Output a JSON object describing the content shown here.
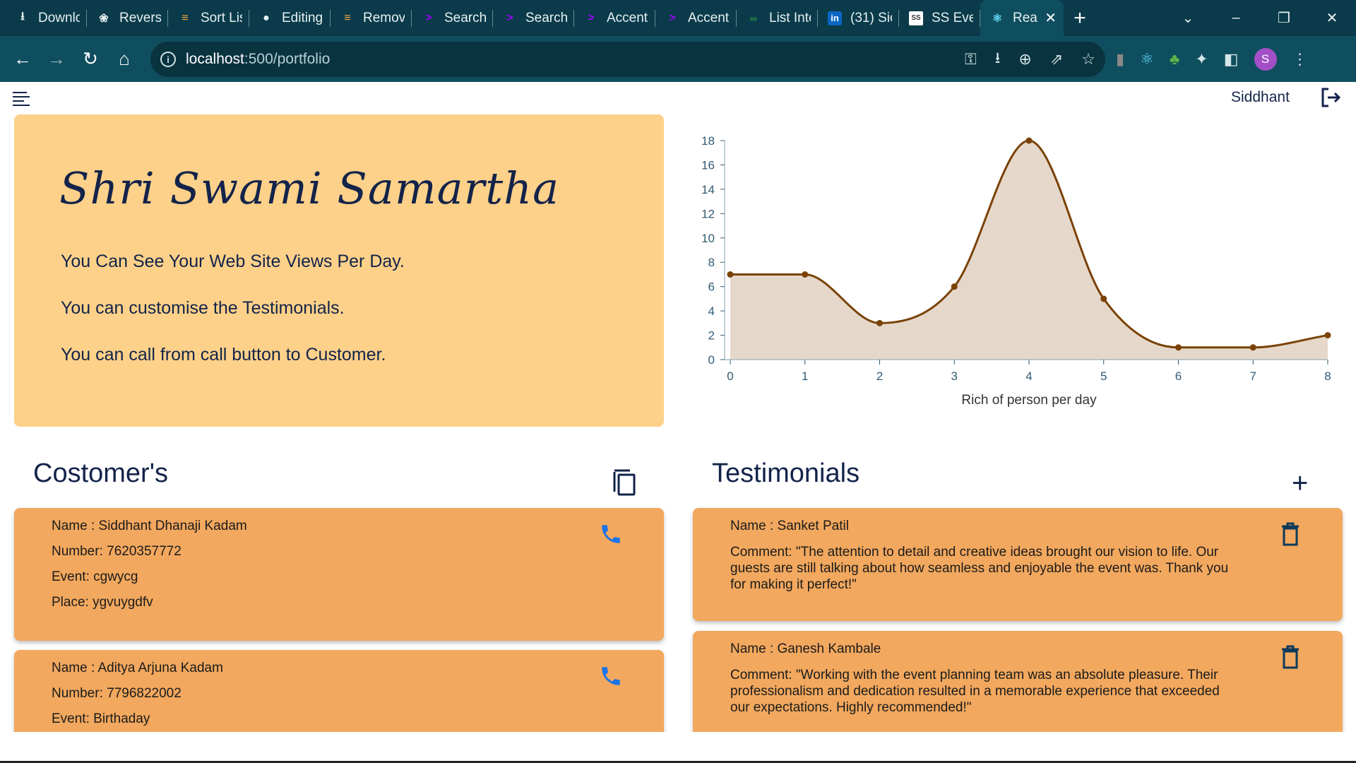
{
  "browser": {
    "tabs": [
      {
        "label": "Downlo",
        "icon": "download-icon"
      },
      {
        "label": "Reverse",
        "icon": "openai-icon"
      },
      {
        "label": "Sort Lis",
        "icon": "stackoverflow-icon"
      },
      {
        "label": "Editing",
        "icon": "github-icon"
      },
      {
        "label": "Remov",
        "icon": "stackoverflow-icon"
      },
      {
        "label": "Search",
        "icon": "accenture-icon"
      },
      {
        "label": "Search",
        "icon": "accenture-icon"
      },
      {
        "label": "Accent",
        "icon": "accenture-icon"
      },
      {
        "label": "Accent",
        "icon": "accenture-icon"
      },
      {
        "label": "List Inte",
        "icon": "gfg-icon"
      },
      {
        "label": "(31) Sic",
        "icon": "linkedin-icon"
      },
      {
        "label": "SS Even",
        "icon": "ss-icon"
      },
      {
        "label": "Rea",
        "icon": "react-icon",
        "active": true
      }
    ],
    "url_host": "localhost",
    "url_rest": ":500/portfolio"
  },
  "header": {
    "username": "Siddhant"
  },
  "hero": {
    "title": "Shri Swami Samartha",
    "lines": [
      "You Can See Your Web Site Views Per Day.",
      "You can customise the Testimonials.",
      "You can call from call button to Customer."
    ]
  },
  "chart_data": {
    "type": "area",
    "x": [
      0,
      1,
      2,
      3,
      4,
      5,
      6,
      7,
      8
    ],
    "values": [
      7,
      7,
      3,
      6,
      18,
      5,
      1,
      1,
      2
    ],
    "xlabel": "Rich of person per day",
    "ylabel": "",
    "xlim": [
      0,
      8
    ],
    "ylim": [
      0,
      18
    ],
    "yticks": [
      0,
      2,
      4,
      6,
      8,
      10,
      12,
      14,
      16,
      18
    ],
    "xticks": [
      0,
      1,
      2,
      3,
      4,
      5,
      6,
      7,
      8
    ],
    "line_color": "#7a4206",
    "fill_color": "#e5d8cb",
    "grid": false,
    "curve": "smooth"
  },
  "customers": {
    "title": "Costomer's",
    "items": [
      {
        "name": "Name : Siddhant Dhanaji Kadam",
        "number": "Number: 7620357772",
        "event": "Event: cgwycg",
        "place": "Place: ygvuygdfv"
      },
      {
        "name": "Name : Aditya Arjuna Kadam",
        "number": "Number: 7796822002",
        "event": "Event: Birthaday"
      }
    ]
  },
  "testimonials": {
    "title": "Testimonials",
    "items": [
      {
        "name": "Name : Sanket Patil",
        "comment": "Comment: \"The attention to detail and creative ideas brought our vision to life. Our guests are still talking about how seamless and enjoyable the event was. Thank you for making it perfect!\""
      },
      {
        "name": "Name : Ganesh Kambale",
        "comment": "Comment: \"Working with the event planning team was an absolute pleasure. Their professionalism and dedication resulted in a memorable experience that exceeded our expectations. Highly recommended!\""
      }
    ]
  },
  "colors": {
    "hero_bg": "#fdd189",
    "card_bg": "#f2a85e",
    "text_dark": "#13234a",
    "phone_blue": "#1a73e8",
    "trash_navy": "#0e3a5a"
  }
}
